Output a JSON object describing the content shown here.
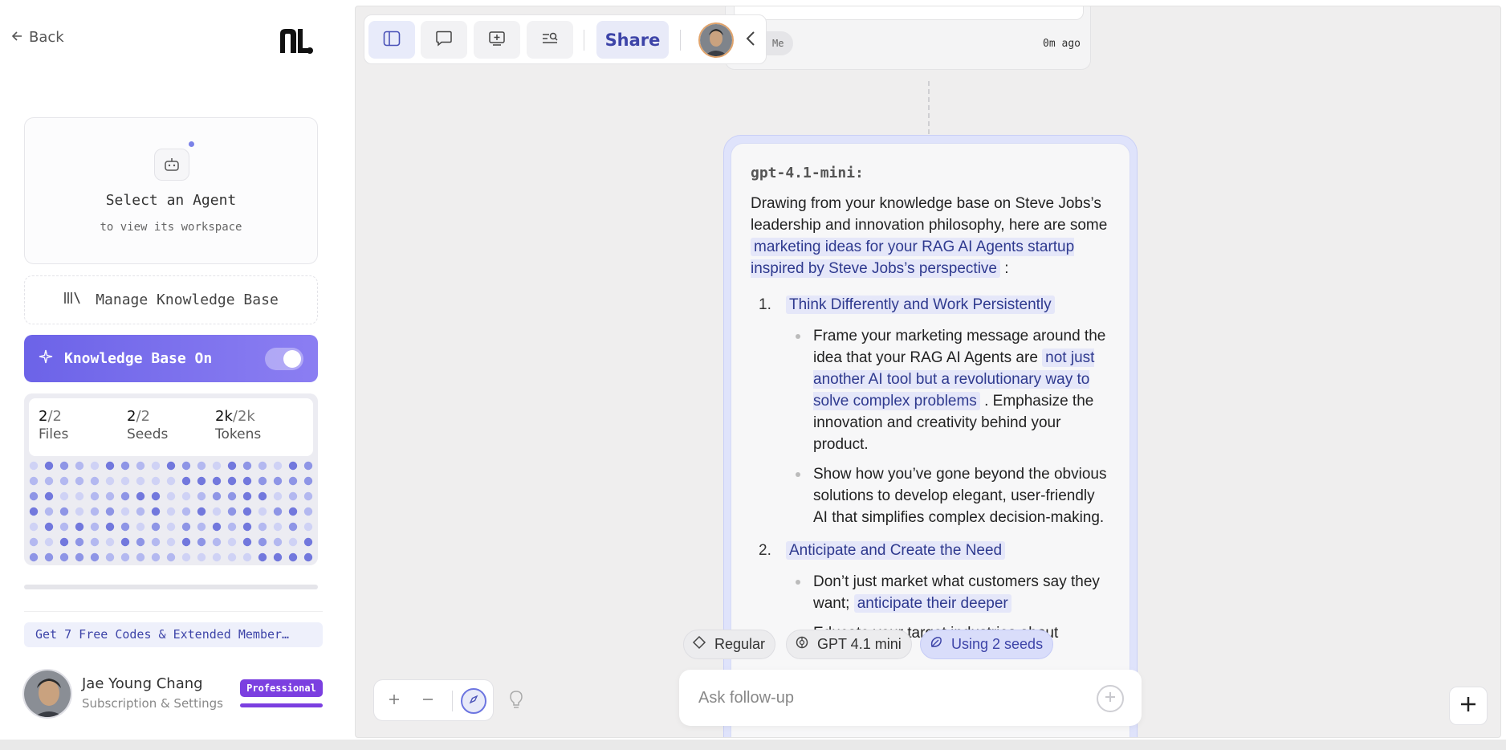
{
  "nav": {
    "back_label": "Back"
  },
  "agent": {
    "title": "Select an Agent",
    "subtitle": "to view its workspace"
  },
  "knowledge": {
    "manage_label": "Manage Knowledge Base",
    "toggle_label": "Knowledge Base On",
    "toggle_on": true,
    "stats": {
      "files": {
        "value": "2",
        "total": "2",
        "label": "Files"
      },
      "seeds": {
        "value": "2",
        "total": "2",
        "label": "Seeds"
      },
      "tokens": {
        "value": "2k",
        "total": "2k",
        "label": "Tokens"
      }
    }
  },
  "promo": {
    "label": "Get 7 Free Codes & Extended Member…"
  },
  "user": {
    "name": "Jae Young Chang",
    "subtitle": "Subscription & Settings",
    "plan": "Professional"
  },
  "toolbar": {
    "share_label": "Share"
  },
  "conversation": {
    "previous": {
      "author_tag": "Me",
      "time": "0m ago"
    },
    "response": {
      "model": "gpt-4.1-mini:",
      "intro_text": "Drawing from your knowledge base on Steve Jobs’s leadership and innovation philosophy, here are some",
      "intro_highlight": "marketing ideas for your RAG AI Agents startup inspired by Steve Jobs’s perspective",
      "intro_tail": ":",
      "items": [
        {
          "number": "1.",
          "title": "Think Differently and Work Persistently",
          "bullet1_pre": "Frame your marketing message around the idea that your RAG AI Agents are",
          "bullet1_highlight": "not just another AI tool but a revolutionary way to solve complex problems",
          "bullet1_post": ". Emphasize the innovation and creativity behind your product.",
          "bullet2": "Show how you’ve gone beyond the obvious solutions to develop elegant, user-friendly AI that simplifies complex decision-making."
        },
        {
          "number": "2.",
          "title": "Anticipate and Create the Need",
          "bullet1_pre": "Don’t just market what customers say they want;",
          "bullet1_highlight": "anticipate their deeper",
          "bullet2": "Educate your target industries about"
        }
      ]
    }
  },
  "composer": {
    "mode_label": "Regular",
    "model_label": "GPT 4.1 mini",
    "seeds_label": "Using 2 seeds",
    "placeholder": "Ask follow-up"
  },
  "colors": {
    "accent": "#6c63e8",
    "highlight_bg": "#e5e7f9",
    "highlight_text": "#2f3a8f",
    "plan_badge": "#7b3fe0"
  }
}
